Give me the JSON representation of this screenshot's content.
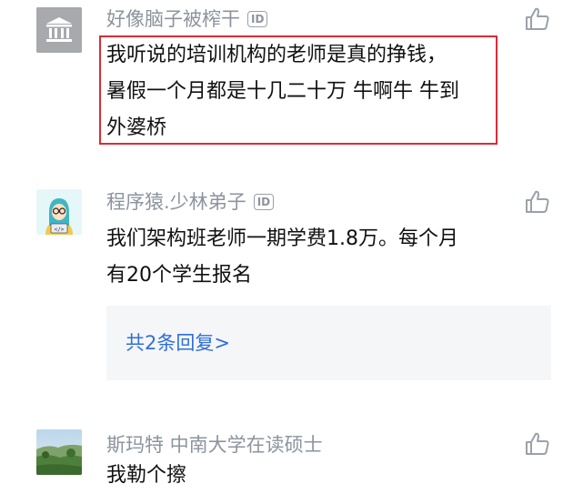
{
  "comments": [
    {
      "username": "好像脑子被榨干",
      "id_badge": "ID",
      "text_lines": [
        "我听说的培训机构的老师是真的挣钱，",
        "暑假一个月都是十几二十万 牛啊牛 牛到",
        "外婆桥"
      ],
      "highlighted": true,
      "avatar": "bank-building-icon"
    },
    {
      "username": "程序猿.少林弟子",
      "id_badge": "ID",
      "text_lines": [
        "我们架构班老师一期学费1.8万。每个月",
        "有20个学生报名"
      ],
      "avatar": "programmer-avatar",
      "replies_label": "共2条回复>"
    },
    {
      "username": "斯玛特 中南大学在读硕士",
      "text_lines": [
        "我勒个擦"
      ],
      "avatar": "landscape-photo-avatar"
    }
  ],
  "icons": {
    "like": "thumbs-up-icon"
  },
  "colors": {
    "username": "#8d949e",
    "text": "#111111",
    "highlight_border": "#dd2a35",
    "reply_link": "#2f6fd9",
    "reply_bg": "#f5f6f8"
  }
}
